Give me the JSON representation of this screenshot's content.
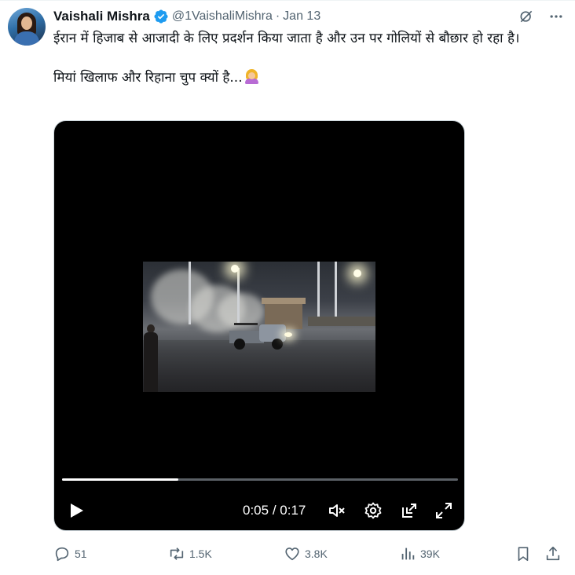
{
  "author": {
    "name": "Vaishali Mishra",
    "handle": "@1VaishaliMishra",
    "separator": "·",
    "date": "Jan 13"
  },
  "tweet": {
    "line1": "ईरान में हिजाब से आजादी के लिए प्रदर्शन किया जाता है और उन पर गोलियों से बौछार हो रहा है।",
    "line2": "मियां खिलाफ और रिहाना चुप क्यों है...",
    "emoji": "woman-shrugging-emoji"
  },
  "video": {
    "current_time": "0:05",
    "time_separator": " / ",
    "duration": "0:17",
    "progress_fraction": 0.294
  },
  "actions": {
    "replies": "51",
    "reposts": "1.5K",
    "likes": "3.8K",
    "views": "39K"
  },
  "colors": {
    "verified": "#1d9bf0",
    "muted_text": "#536471",
    "text": "#0f1419"
  },
  "icons": [
    "verified-badge-icon",
    "grok-icon",
    "more-icon",
    "play-icon",
    "volume-muted-icon",
    "settings-icon",
    "pop-out-icon",
    "fullscreen-icon",
    "reply-icon",
    "repost-icon",
    "like-icon",
    "views-icon",
    "bookmark-icon",
    "share-icon"
  ]
}
